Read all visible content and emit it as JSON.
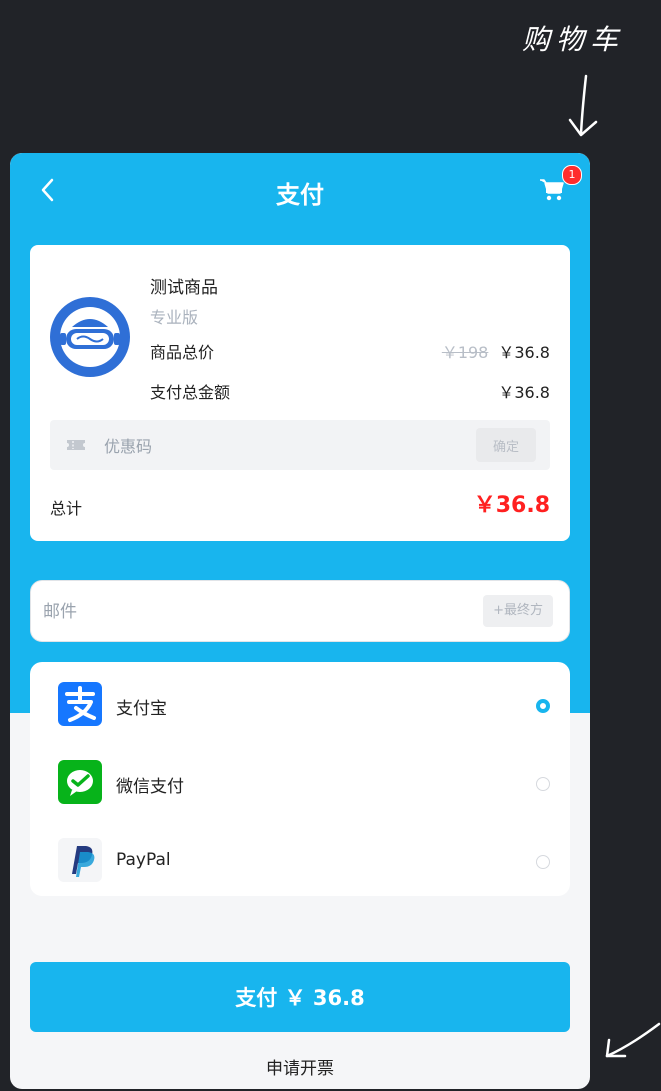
{
  "annotation": {
    "cart_note": "购物车"
  },
  "header": {
    "title": "支付",
    "cart_badge": "1"
  },
  "product": {
    "name": "测试商品",
    "edition": "专业版",
    "subtotal_label": "商品总价",
    "original_price": "￥198",
    "price": "￥36.8",
    "pay_total_label": "支付总金额",
    "pay_total": "￥36.8"
  },
  "coupon": {
    "placeholder": "优惠码",
    "confirm_label": "确定"
  },
  "total": {
    "label": "总计",
    "value": "￥36.8"
  },
  "email": {
    "placeholder": "邮件",
    "suffix": "+最终方"
  },
  "payment_methods": [
    {
      "label": "支付宝",
      "icon": "alipay-icon",
      "selected": true
    },
    {
      "label": "微信支付",
      "icon": "wechat-pay-icon",
      "selected": false
    },
    {
      "label": "PayPal",
      "icon": "paypal-icon",
      "selected": false
    }
  ],
  "actions": {
    "pay_label": "支付 ￥ 36.8",
    "invoice_label": "申请开票"
  },
  "colors": {
    "accent": "#18b5ee",
    "total": "#ff2020",
    "alipay": "#1677ff",
    "wechat": "#07b31a",
    "paypal": "#253b80"
  }
}
